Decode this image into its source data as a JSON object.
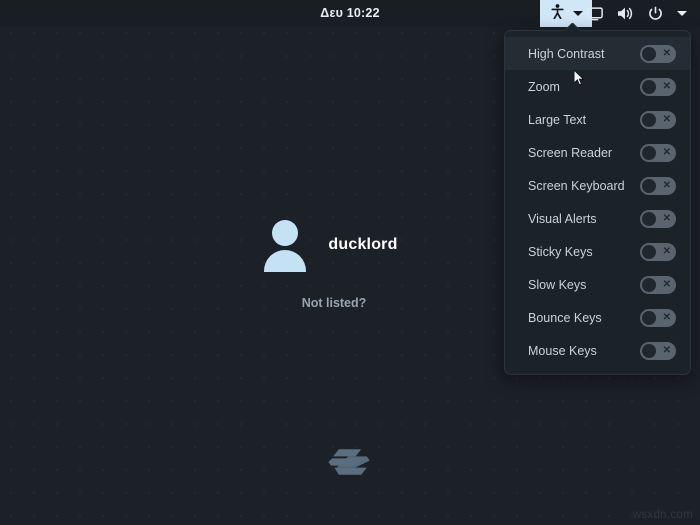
{
  "topbar": {
    "clock": "Δευ 10:22",
    "accessibility_button": {
      "icon": "accessibility-icon",
      "caret_icon": "chevron-down-icon",
      "expanded": true
    },
    "tray_items": [
      {
        "name": "display-icon",
        "label": "Display"
      },
      {
        "name": "volume-icon",
        "label": "Volume"
      },
      {
        "name": "power-icon",
        "label": "Power"
      },
      {
        "name": "chevron-down-icon",
        "label": "More"
      }
    ]
  },
  "a11y_menu": {
    "items": [
      {
        "label": "High Contrast",
        "state": "off",
        "mark": "✕",
        "hovered": true
      },
      {
        "label": "Zoom",
        "state": "off",
        "mark": "✕",
        "hovered": false
      },
      {
        "label": "Large Text",
        "state": "off",
        "mark": "✕",
        "hovered": false
      },
      {
        "label": "Screen Reader",
        "state": "off",
        "mark": "✕",
        "hovered": false
      },
      {
        "label": "Screen Keyboard",
        "state": "off",
        "mark": "✕",
        "hovered": false
      },
      {
        "label": "Visual Alerts",
        "state": "off",
        "mark": "✕",
        "hovered": false
      },
      {
        "label": "Sticky Keys",
        "state": "off",
        "mark": "✕",
        "hovered": false
      },
      {
        "label": "Slow Keys",
        "state": "off",
        "mark": "✕",
        "hovered": false
      },
      {
        "label": "Bounce Keys",
        "state": "off",
        "mark": "✕",
        "hovered": false
      },
      {
        "label": "Mouse Keys",
        "state": "off",
        "mark": "✕",
        "hovered": false
      }
    ]
  },
  "login": {
    "avatar_icon": "user-avatar-icon",
    "username": "ducklord",
    "not_listed_label": "Not listed?"
  },
  "branding": {
    "logo_icon": "zorin-logo-icon"
  },
  "watermark": "wsxdn.com",
  "colors": {
    "background": "#1c2127",
    "topbar": "#191e23",
    "menu_background": "#1b2228",
    "menu_border": "#2c343c",
    "menu_hover": "#242c34",
    "accent_highlight": "#cfe7f8",
    "avatar": "#c5e2f5",
    "switch_track": "#59646e",
    "switch_knob": "#20272d",
    "label_text": "#c8d3dc",
    "logo": "#5b6e80"
  }
}
